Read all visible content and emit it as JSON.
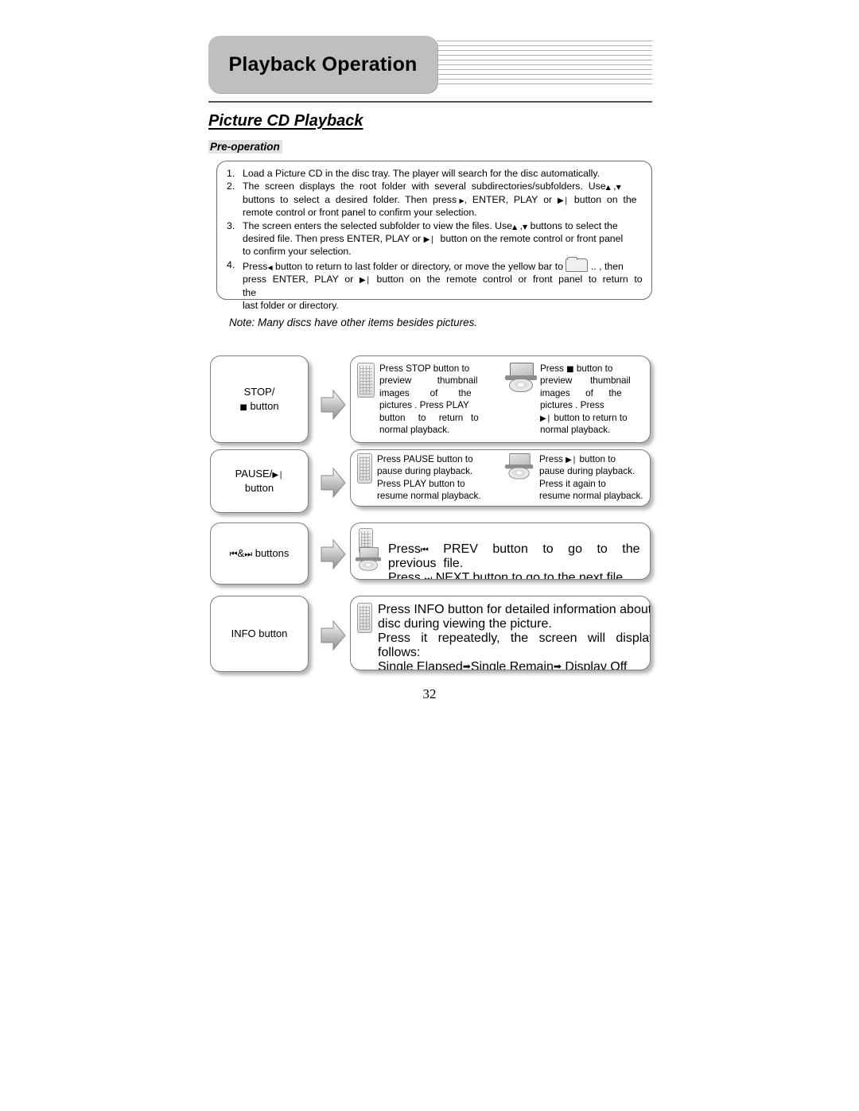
{
  "header": {
    "chapter_title": "Playback Operation",
    "stripe_count": 10
  },
  "section": {
    "title": "Picture CD Playback",
    "subsection": "Pre-operation"
  },
  "pre_operation": {
    "items": [
      {
        "number": "1.",
        "lines": [
          "Load a Picture CD in the disc tray. The player will search for the disc automatically."
        ]
      },
      {
        "number": "2.",
        "lines": [
          "The screen displays the root folder with several subdirectories/subfolders. Use ▲ , ▼",
          "buttons to select a desired folder. Then press ▶ , ENTER, PLAY or ▶❙ button on the",
          "remote control or front panel to confirm your selection."
        ]
      },
      {
        "number": "3.",
        "lines": [
          "The screen enters the selected subfolder to view the files. Use ▲ , ▼ buttons to select the",
          "desired file. Then press ENTER, PLAY or ▶❙ button on the remote control or front panel",
          "to confirm your selection."
        ]
      },
      {
        "number": "4.",
        "lines": [
          "Press ◀ button to return to last folder or directory, or move the yellow bar to [folder] .. , then",
          "press ENTER, PLAY or ▶❙ button on the remote control or front panel to return to the",
          "last folder or directory."
        ]
      }
    ]
  },
  "note": "Note: Many discs have other items besides pictures.",
  "flow_rows": [
    {
      "left_label_lines": [
        "STOP/",
        "■ button"
      ],
      "left_icon": "none",
      "columns": [
        {
          "icon": "remote-control-icon",
          "text": "Press STOP button to preview thumbnail images of the pictures . Press PLAY button to return to normal playback."
        },
        {
          "icon": "portable-dvd-player-icon",
          "text": "Press ■ button to preview thumbnail images of the pictures . Press ▶❙ button to return to normal playback."
        }
      ]
    },
    {
      "left_label_lines": [
        "PAUSE/▶❙",
        "button"
      ],
      "left_icon": "none",
      "columns": [
        {
          "icon": "remote-control-icon",
          "text": "Press PAUSE button to pause during playback. Press PLAY button to resume normal playback."
        },
        {
          "icon": "portable-dvd-player-icon",
          "text": "Press ▶❙ button to pause during playback. Press it again to resume normal playback."
        }
      ]
    },
    {
      "left_label_lines": [
        "◀◀ & ▶▶ buttons"
      ],
      "left_icon": "none",
      "columns": [
        {
          "icon": "remote-and-player-icon",
          "text": "Press ◀◀ PREV button to go to the previous file. Press ▶▶ NEXT button to go to the next file."
        }
      ]
    },
    {
      "left_label_lines": [
        "INFO button"
      ],
      "left_icon": "none",
      "columns": [
        {
          "icon": "remote-control-icon",
          "text": "Press INFO button for detailed information about the disc during viewing the picture. Press it repeatedly, the screen will display as follows: Single Elapsed ➞ Single Remain ➞ Display Off"
        }
      ]
    }
  ],
  "flow_text": {
    "row1_col1": {
      "l1": "Press STOP button to",
      "l2": "preview          thumbnail",
      "l3": "images        of        the",
      "l4": "pictures . Press PLAY",
      "l5": "button     to     return   to",
      "l6": "normal playback."
    },
    "row1_col2": {
      "l1": "Press ■ button to",
      "l2": "preview         thumbnail",
      "l3": "images       of       the",
      "l4": "pictures . Press",
      "l5": "▶❙ button to return to",
      "l6": "normal playback."
    },
    "row2_col1": {
      "l1": "Press PAUSE button to",
      "l2": "pause during playback.",
      "l3": "Press PLAY button to",
      "l4": "resume normal playback."
    },
    "row2_col2": {
      "l1": "Press ▶❙ button to",
      "l2": "pause during playback.",
      "l3": "Press it again to",
      "l4": "resume normal playback."
    },
    "row3": {
      "l1": "Press ◀◀ PREV button to go to the previous file.",
      "l2": "Press ▶▶ NEXT button to go to the next file."
    },
    "row4": {
      "l1": "Press INFO button for detailed information about the",
      "l2": "disc during viewing the picture.",
      "l3": "Press   it   repeatedly,   the   screen   will   display   as",
      "l4": "follows:",
      "l5a": "Single Elapsed",
      "l5b": "Single Remain",
      "l5c": "Display Off"
    }
  },
  "labels": {
    "row1_left_1": "STOP/",
    "row1_left_2": "button",
    "row2_left_1": "PAUSE/",
    "row2_left_2": "button",
    "row3_left": "buttons",
    "row4_left": "INFO button"
  },
  "footer": {
    "page_number": "32"
  },
  "colors": {
    "header_tab_bg": "#bfbfbf",
    "stripe": "#b2b2b2",
    "box_border": "#7d7d7d",
    "subsection_bg": "#e2e2e2",
    "rule": "#555555"
  }
}
